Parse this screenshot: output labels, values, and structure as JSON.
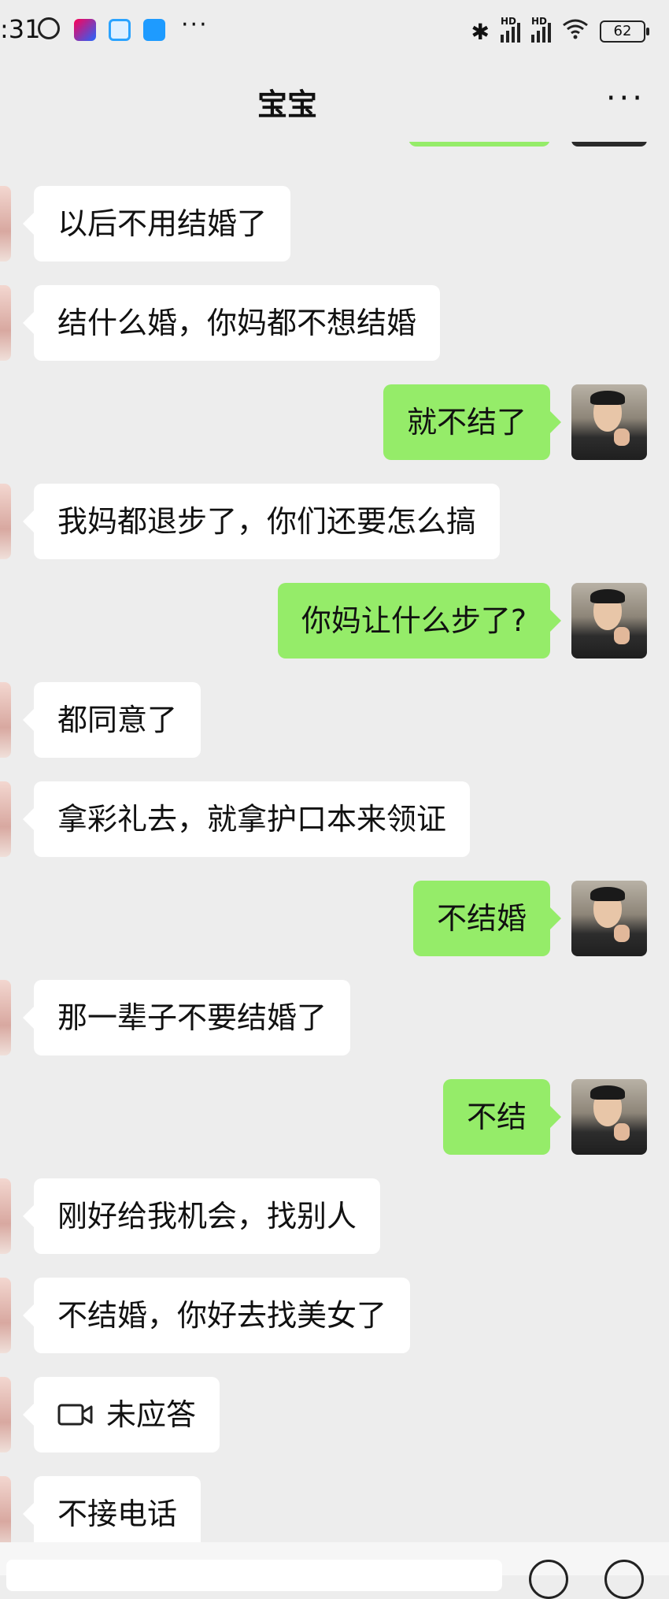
{
  "status_bar": {
    "time": ":31",
    "more": "···",
    "signal_1": "HD",
    "signal_2": "HD",
    "battery": "62"
  },
  "header": {
    "title": "宝宝",
    "more": "···"
  },
  "messages": [
    {
      "dir": "in",
      "text": "以后不用结婚了"
    },
    {
      "dir": "in",
      "text": "结什么婚，你妈都不想结婚"
    },
    {
      "dir": "out",
      "text": "就不结了"
    },
    {
      "dir": "in",
      "text": "我妈都退步了，你们还要怎么搞"
    },
    {
      "dir": "out",
      "text": "你妈让什么步了?"
    },
    {
      "dir": "in",
      "text": "都同意了"
    },
    {
      "dir": "in",
      "text": "拿彩礼去，就拿护口本来领证"
    },
    {
      "dir": "out",
      "text": "不结婚"
    },
    {
      "dir": "in",
      "text": "那一辈子不要结婚了"
    },
    {
      "dir": "out",
      "text": "不结"
    },
    {
      "dir": "in",
      "text": "刚好给我机会，找别人"
    },
    {
      "dir": "in",
      "text": "不结婚，你好去找美女了"
    },
    {
      "dir": "in",
      "text": "未应答",
      "icon": "video-call-icon"
    },
    {
      "dir": "in",
      "text": "不接电话"
    }
  ],
  "colors": {
    "background": "#ededed",
    "incoming_bubble": "#ffffff",
    "outgoing_bubble": "#95ec69"
  }
}
